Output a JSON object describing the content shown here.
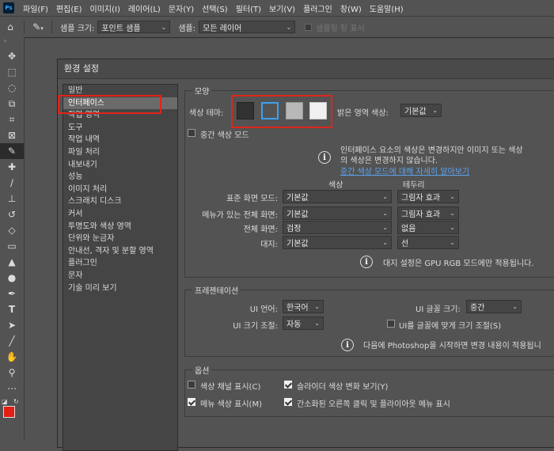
{
  "menubar": {
    "logo": "Ps",
    "items": [
      "파일(F)",
      "편집(E)",
      "이미지(I)",
      "레이어(L)",
      "문자(Y)",
      "선택(S)",
      "필터(T)",
      "보기(V)",
      "플러그인",
      "창(W)",
      "도움말(H)"
    ]
  },
  "options": {
    "sample_size_label": "샘플 크기:",
    "sample_size_value": "포인트 샘플",
    "sample_label": "샘플:",
    "sample_value": "모든 레이어",
    "sampling_ring_label": "샘플링 링 표시"
  },
  "dialog": {
    "title": "환경 설정",
    "left_items": [
      "일반",
      "인터페이스",
      "작업 영역",
      "도구",
      "작업 내역",
      "파일 처리",
      "내보내기",
      "성능",
      "이미지 처리",
      "스크래치 디스크",
      "커서",
      "투명도와 색상 영역",
      "단위와 눈금자",
      "안내선, 격자 및 분할 영역",
      "플러그인",
      "문자",
      "기술 미리 보기"
    ],
    "selected_index": 1,
    "appearance": {
      "title": "모양",
      "color_theme_label": "색상 테마:",
      "swatch_colors": [
        "#323232",
        "#535353",
        "#b8b8b8",
        "#f0f0f0"
      ],
      "highlight_label": "밝은 영역 색상:",
      "highlight_value": "기본값",
      "medium_mode_label": "중간 색상 모드",
      "info_line1": "인터페이스 요소의 색상은 변경하지만 이미지 또는 색상",
      "info_line2": "의 색상은 변경하지 않습니다.",
      "info_link": "중간 색상 모드에 대해 자세히 알아보기",
      "col_color": "색상",
      "col_border": "테두리",
      "rows": [
        {
          "label": "표준 화면 모드:",
          "color": "기본값",
          "border": "그림자 효과"
        },
        {
          "label": "메뉴가 있는 전체 화면:",
          "color": "기본값",
          "border": "그림자 효과"
        },
        {
          "label": "전체 화면:",
          "color": "검정",
          "border": "없음"
        },
        {
          "label": "대지:",
          "color": "기본값",
          "border": "선"
        }
      ],
      "artboard_note": "대지 설정은 GPU RGB 모드에만 적용됩니다."
    },
    "presentation": {
      "title": "프레젠테이션",
      "ui_lang_label": "UI 언어:",
      "ui_lang_value": "한국어",
      "ui_font_label": "UI 글꼴 크기:",
      "ui_font_value": "중간",
      "ui_scale_label": "UI 크기 조절:",
      "ui_scale_value": "자동",
      "scale_to_font_label": "UI를 글꼴에 맞게 크기 조절(S)",
      "restart_note": "다음에 Photoshop을 시작하면 변경 내용이 적용됩니"
    },
    "options_group": {
      "title": "옵션",
      "items": [
        {
          "label": "색상 채널 표시(C)",
          "checked": false
        },
        {
          "label": "슬라이더 색상 변화 보기(Y)",
          "checked": true
        },
        {
          "label": "메뉴 색상 표시(M)",
          "checked": true
        },
        {
          "label": "간소화된 오른쪽 클릭 및 플라이아웃 메뉴 표시",
          "checked": true
        }
      ]
    }
  }
}
